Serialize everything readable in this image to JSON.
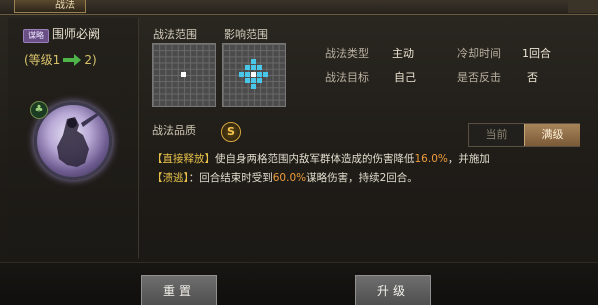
{
  "window": {
    "title": "战法"
  },
  "skill": {
    "type_badge": "谋略",
    "name": "围师必阙",
    "level_open": "(等级1",
    "level_close": "2)",
    "clover_icon": "clover-icon"
  },
  "ranges": {
    "tactic_range_label": "战法范围",
    "effect_range_label": "影响范围"
  },
  "stats": {
    "type_label": "战法类型",
    "type_value": "主动",
    "cooldown_label": "冷却时间",
    "cooldown_value": "1回合",
    "target_label": "战法目标",
    "target_value": "自己",
    "counter_label": "是否反击",
    "counter_value": "否"
  },
  "quality": {
    "label": "战法品质",
    "grade": "S",
    "grade_color": "#f4c54f"
  },
  "toggle": {
    "current": "当前",
    "max": "满级"
  },
  "description": {
    "tag1": "【直接释放】",
    "part1": "使自身两格范围内敌军群体造成的伤害降低",
    "value1": "16.0%",
    "part2": "，并施加",
    "tag2": "【溃逃】",
    "part3": "：回合结束时受到",
    "value2": "60.0%",
    "part4": "谋略伤害，持续2回合。"
  },
  "buttons": {
    "reset": "重置",
    "upgrade": "升级"
  },
  "colors": {
    "accent_gold": "#e8c24a",
    "highlight_orange": "#ee9b3b",
    "range_cyan": "#49c7e8"
  }
}
